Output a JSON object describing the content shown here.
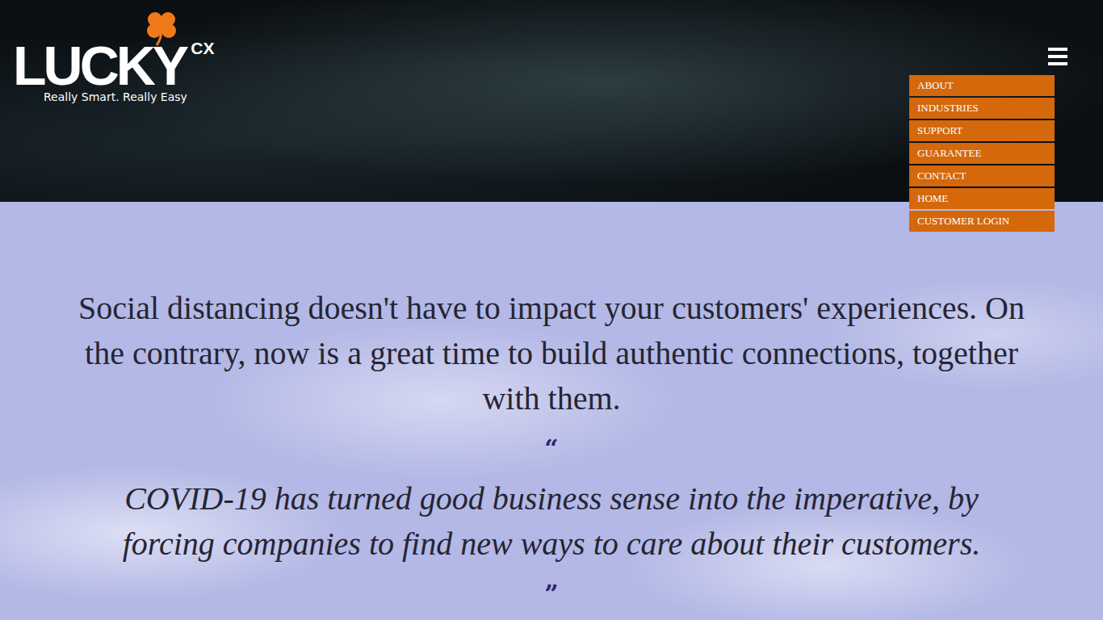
{
  "logo": {
    "name": "LUCKY",
    "suffix": "CX",
    "tagline": "Really Smart. Really Easy"
  },
  "menu": {
    "open": true,
    "items": [
      {
        "label": "ABOUT"
      },
      {
        "label": "INDUSTRIES"
      },
      {
        "label": "SUPPORT"
      },
      {
        "label": "GUARANTEE"
      },
      {
        "label": "CONTACT"
      },
      {
        "label": "HOME"
      },
      {
        "label": "CUSTOMER LOGIN"
      }
    ]
  },
  "hero": {
    "heading": "Social distancing doesn't have to impact your customers' experiences. On the contrary, now is a great time to build authentic connections, together with them.",
    "quote_open": "“",
    "quote": "COVID-19 has turned good business sense into the imperative, by forcing companies to find new ways to care about their customers.",
    "quote_close": "”"
  }
}
